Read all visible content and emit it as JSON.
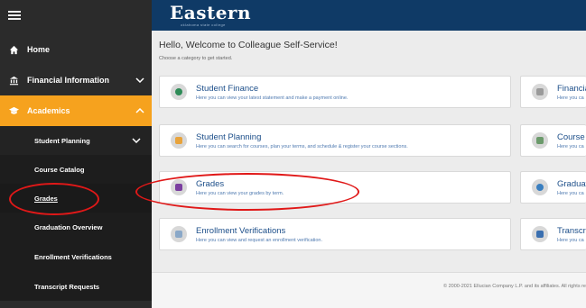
{
  "sidebar": {
    "items": [
      {
        "label": "Home",
        "icon": "home-icon"
      },
      {
        "label": "Financial Information",
        "icon": "bank-icon"
      },
      {
        "label": "Academics",
        "icon": "graduation-cap-icon"
      }
    ],
    "academics_sub": [
      {
        "label": "Student Planning"
      },
      {
        "label": "Course Catalog"
      },
      {
        "label": "Grades"
      },
      {
        "label": "Graduation Overview"
      },
      {
        "label": "Enrollment Verifications"
      },
      {
        "label": "Transcript Requests"
      }
    ]
  },
  "header": {
    "logo_text": "Eastern",
    "logo_sub": "oklahoma state college"
  },
  "main": {
    "welcome": "Hello, Welcome to Colleague Self-Service!",
    "subtitle": "Choose a category to get started.",
    "cards_left": [
      {
        "title": "Student Finance",
        "desc": "Here you can view your latest statement and make a payment online.",
        "color": "#2e8b57"
      },
      {
        "title": "Student Planning",
        "desc": "Here you can search for courses, plan your terms, and schedule & register your course sections.",
        "color": "#e8a33c"
      },
      {
        "title": "Grades",
        "desc": "Here you can view your grades by term.",
        "color": "#7b3fa0"
      },
      {
        "title": "Enrollment Verifications",
        "desc": "Here you can view and request an enrollment verification.",
        "color": "#8aa8c8"
      }
    ],
    "cards_right": [
      {
        "title": "Financia",
        "desc": "Here you ca",
        "color": "#9a9a9a"
      },
      {
        "title": "Course C",
        "desc": "Here you ca",
        "color": "#6b9a6b"
      },
      {
        "title": "Graduati",
        "desc": "Here you ca",
        "color": "#3a7fc0"
      },
      {
        "title": "Transcrip",
        "desc": "Here you ca",
        "color": "#3a6fb0"
      }
    ],
    "footer": "© 2000-2021 Ellucian Company L.P. and its affiliates. All rights re"
  },
  "colors": {
    "sidebar_bg": "#2b2b2b",
    "accent": "#f6a21e",
    "header_bg": "#0f3a66",
    "annotation": "#e01818"
  }
}
